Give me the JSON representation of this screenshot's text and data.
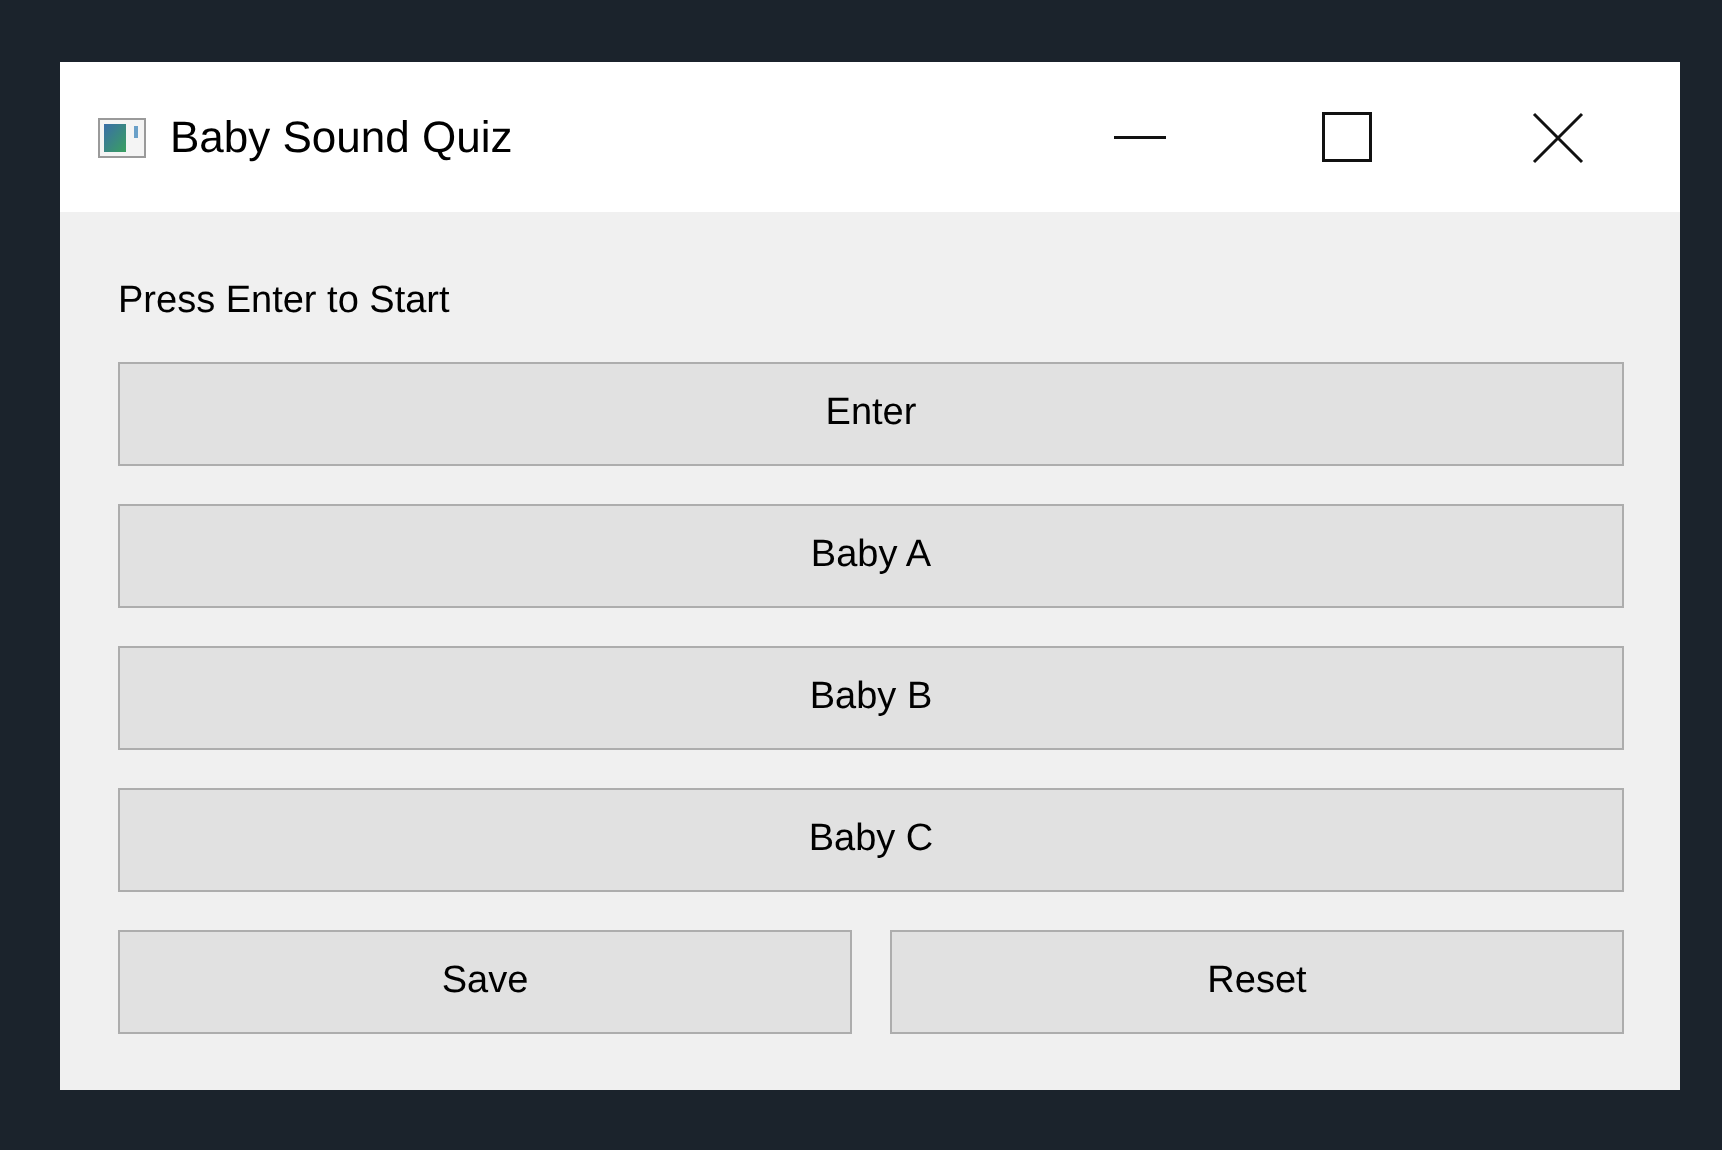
{
  "window": {
    "title": "Baby Sound Quiz"
  },
  "prompt": "Press Enter to Start",
  "buttons": [
    {
      "label": "Enter"
    },
    {
      "label": "Baby A"
    },
    {
      "label": "Baby B"
    },
    {
      "label": "Baby C"
    }
  ],
  "bottom_buttons": [
    {
      "label": "Save"
    },
    {
      "label": "Reset"
    }
  ]
}
